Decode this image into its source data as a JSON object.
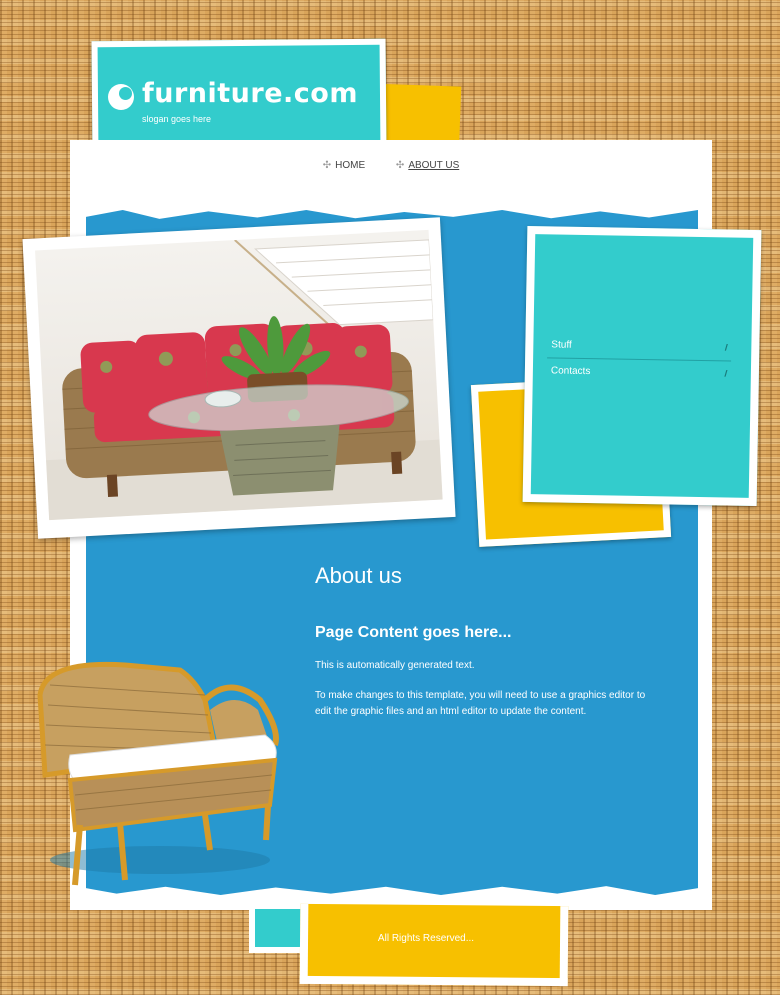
{
  "header": {
    "site_title": "furniture.com",
    "slogan": "slogan goes here"
  },
  "nav": {
    "items": [
      {
        "label": "HOME"
      },
      {
        "label": "ABOUT US"
      }
    ]
  },
  "sidebar": {
    "items": [
      {
        "label": "Stuff"
      },
      {
        "label": "Contacts"
      }
    ]
  },
  "content": {
    "heading": "About us",
    "subheading": "Page Content goes here...",
    "paragraph1": "This is automatically generated text.",
    "paragraph2": "To make changes to this template, you will need to use a graphics editor to edit the graphic files and an html editor to update the content."
  },
  "footer": {
    "text": "All Rights Reserved..."
  },
  "colors": {
    "teal": "#33cccc",
    "blue": "#2898cf",
    "yellow": "#f7c000",
    "background_wood": "#d9a45a"
  },
  "icons": [
    "logo-mark-icon",
    "nav-bullet-icon",
    "double-arrow-icon"
  ]
}
